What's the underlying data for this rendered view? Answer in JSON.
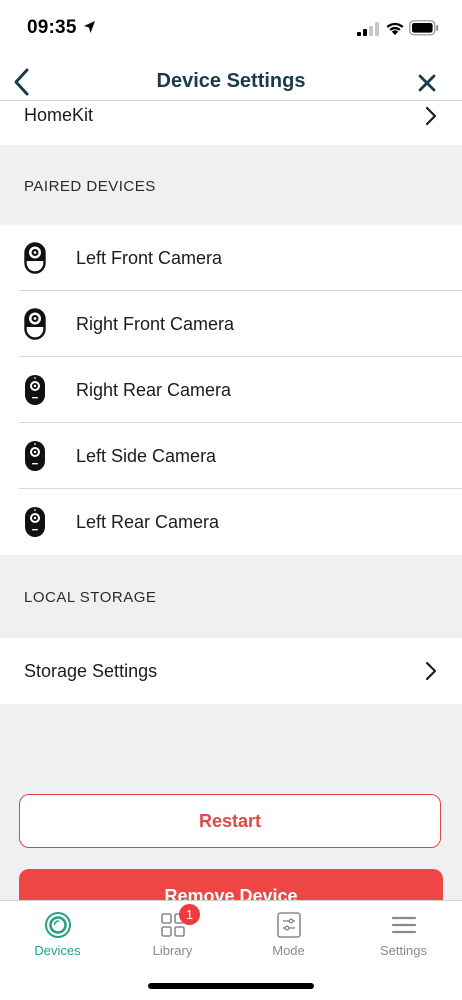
{
  "status_bar": {
    "time": "09:35"
  },
  "nav": {
    "title": "Device Settings"
  },
  "homekit": {
    "label": "HomeKit"
  },
  "paired_devices": {
    "header": "PAIRED DEVICES",
    "devices": [
      {
        "name": "Left Front Camera",
        "icon": "indoor-camera-icon"
      },
      {
        "name": "Right Front Camera",
        "icon": "indoor-camera-icon"
      },
      {
        "name": "Right Rear Camera",
        "icon": "outdoor-camera-icon"
      },
      {
        "name": "Left Side Camera",
        "icon": "outdoor-camera-icon"
      },
      {
        "name": "Left Rear Camera",
        "icon": "outdoor-camera-icon"
      }
    ]
  },
  "local_storage": {
    "header": "LOCAL STORAGE",
    "storage_settings_label": "Storage Settings"
  },
  "actions": {
    "restart_label": "Restart",
    "remove_label": "Remove Device"
  },
  "tabbar": {
    "tabs": [
      {
        "label": "Devices",
        "icon": "devices-icon",
        "active": true
      },
      {
        "label": "Library",
        "icon": "library-icon",
        "badge": "1"
      },
      {
        "label": "Mode",
        "icon": "mode-icon"
      },
      {
        "label": "Settings",
        "icon": "settings-icon"
      }
    ]
  },
  "colors": {
    "accent": "#2aa181",
    "danger": "#ee4545",
    "title": "#1b3a4b",
    "section_bg": "#eef0f2"
  }
}
